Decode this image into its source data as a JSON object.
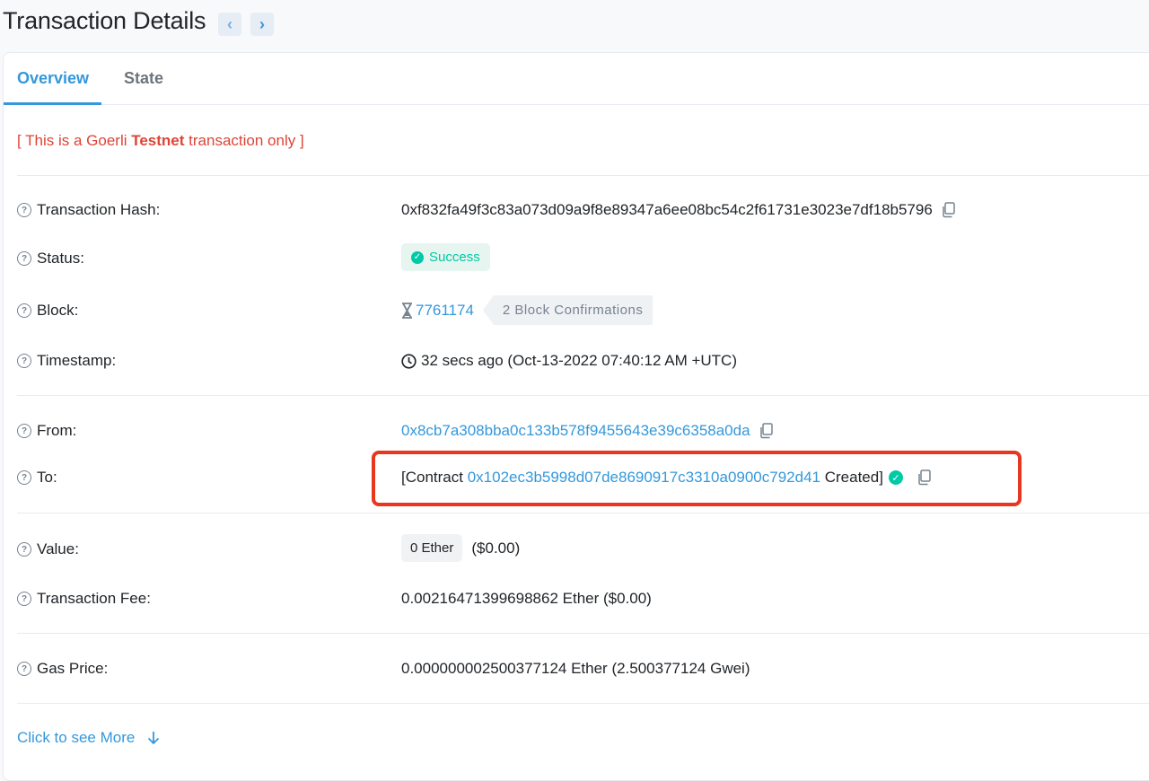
{
  "header": {
    "title": "Transaction Details",
    "prev_label": "‹",
    "next_label": "›"
  },
  "tabs": [
    {
      "label": "Overview",
      "active": true
    },
    {
      "label": "State",
      "active": false
    }
  ],
  "notice": {
    "prefix": "[ This is a Goerli ",
    "bold": "Testnet",
    "suffix": " transaction only ]"
  },
  "rows": {
    "hash": {
      "label": "Transaction Hash:",
      "value": "0xf832fa49f3c83a073d09a9f8e89347a6ee08bc54c2f61731e3023e7df18b5796"
    },
    "status": {
      "label": "Status:",
      "value": "Success"
    },
    "block": {
      "label": "Block:",
      "number": "7761174",
      "confirmations": "2 Block Confirmations"
    },
    "timestamp": {
      "label": "Timestamp:",
      "value": "32 secs ago (Oct-13-2022 07:40:12 AM +UTC)"
    },
    "from": {
      "label": "From:",
      "value": "0x8cb7a308bba0c133b578f9455643e39c6358a0da"
    },
    "to": {
      "label": "To:",
      "prefix": "[Contract ",
      "address": "0x102ec3b5998d07de8690917c3310a0900c792d41",
      "suffix": " Created]"
    },
    "value": {
      "label": "Value:",
      "badge": "0 Ether",
      "usd": "($0.00)"
    },
    "fee": {
      "label": "Transaction Fee:",
      "value": "0.00216471399698862 Ether ($0.00)"
    },
    "gas": {
      "label": "Gas Price:",
      "value": "0.000000002500377124 Ether (2.500377124 Gwei)"
    }
  },
  "footer": {
    "see_more": "Click to see More"
  },
  "colors": {
    "accent": "#3498db",
    "success": "#00c9a7",
    "danger": "#de4437",
    "highlight": "#e8361f"
  }
}
